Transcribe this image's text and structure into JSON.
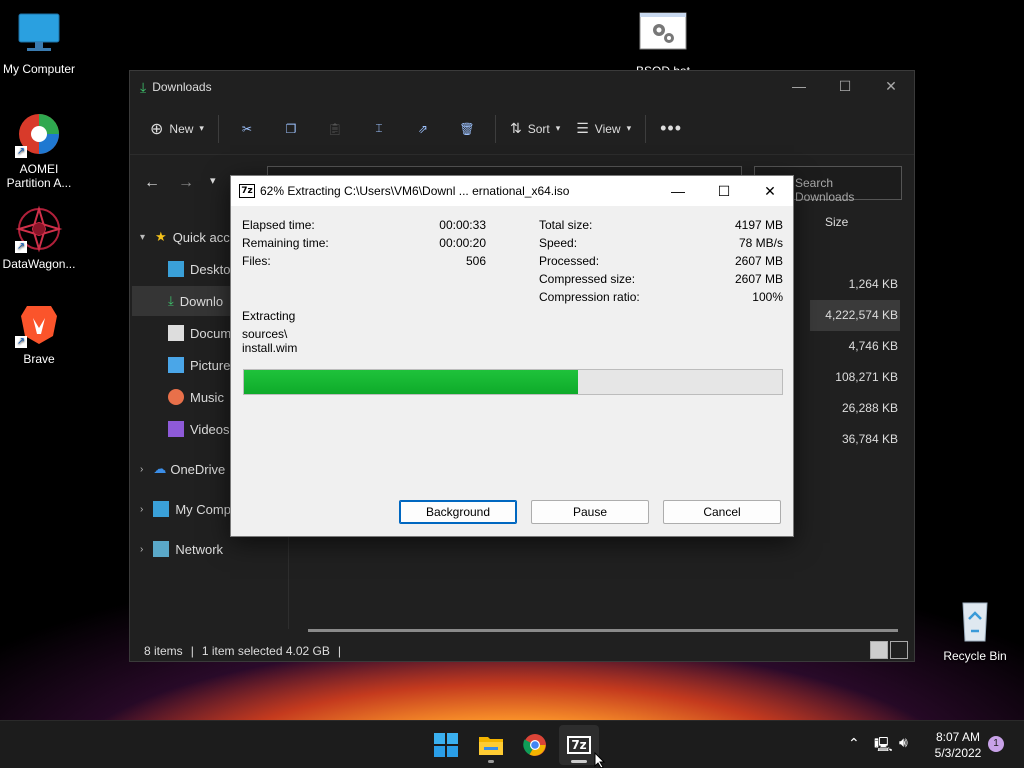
{
  "desktop": {
    "icons": [
      {
        "label": "My Computer"
      },
      {
        "label": "AOMEI Partition A..."
      },
      {
        "label": "DataWagon..."
      },
      {
        "label": "Brave"
      },
      {
        "label": "BSOD.bat"
      },
      {
        "label": "Recycle Bin"
      }
    ]
  },
  "explorer": {
    "title": "Downloads",
    "toolbar": {
      "new_label": "New",
      "sort_label": "Sort",
      "view_label": "View"
    },
    "search_placeholder": "Search Downloads",
    "nav": [
      {
        "label": "Quick acc"
      },
      {
        "label": "Desktop"
      },
      {
        "label": "Downlo"
      },
      {
        "label": "Docum"
      },
      {
        "label": "Pictures"
      },
      {
        "label": "Music"
      },
      {
        "label": "Videos"
      },
      {
        "label": "OneDrive"
      },
      {
        "label": "My Comp"
      },
      {
        "label": "Network"
      }
    ],
    "columns": {
      "size": "Size"
    },
    "sizes": [
      "1,264 KB",
      "4,222,574 KB",
      "4,746 KB",
      "108,271 KB",
      "26,288 KB",
      "36,784 KB"
    ],
    "status": {
      "items": "8 items",
      "selected": "1 item selected  4.02 GB"
    }
  },
  "zip_dialog": {
    "title": "62% Extracting C:\\Users\\VM6\\Downl ... ernational_x64.iso",
    "left_stats": [
      {
        "label": "Elapsed time:",
        "value": "00:00:33"
      },
      {
        "label": "Remaining time:",
        "value": "00:00:20"
      },
      {
        "label": "Files:",
        "value": "506"
      }
    ],
    "right_stats": [
      {
        "label": "Total size:",
        "value": "4197 MB"
      },
      {
        "label": "Speed:",
        "value": "78 MB/s"
      },
      {
        "label": "Processed:",
        "value": "2607 MB"
      },
      {
        "label": "Compressed size:",
        "value": "2607 MB"
      },
      {
        "label": "Compression ratio:",
        "value": "100%"
      }
    ],
    "operation": "Extracting",
    "path_line1": "sources\\",
    "path_line2": "install.wim",
    "progress_percent": 62,
    "buttons": {
      "background": "Background",
      "pause": "Pause",
      "cancel": "Cancel"
    }
  },
  "taskbar": {
    "clock_time": "8:07 AM",
    "clock_date": "5/3/2022",
    "notification_count": "1"
  }
}
